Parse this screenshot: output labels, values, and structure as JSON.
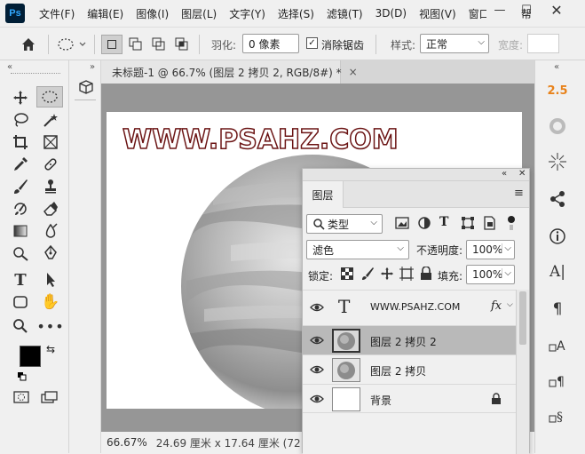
{
  "app": {
    "logo": "Ps"
  },
  "menubar": {
    "items": [
      "文件(F)",
      "编辑(E)",
      "图像(I)",
      "图层(L)",
      "文字(Y)",
      "选择(S)",
      "滤镜(T)",
      "3D(D)",
      "视图(V)",
      "窗口(W)",
      "帮"
    ],
    "minimize": "—",
    "restore": "☐"
  },
  "options": {
    "feather_label": "羽化:",
    "feather_value": "0 像素",
    "antialias_label": "消除锯齿",
    "style_label": "样式:",
    "style_value": "正常",
    "width_label": "宽度:"
  },
  "document": {
    "tab_title": "未标题-1 @ 66.7% (图层 2 拷贝 2, RGB/8#) *",
    "tab_close": "×",
    "watermark": "WWW.PSAHZ.COM",
    "zoom": "66.67%",
    "dimensions": "24.69 厘米 x 17.64 厘米 (72 ppi)"
  },
  "rightstrip": {
    "brush_size": "2.5"
  },
  "layers_panel": {
    "title": "图层",
    "filter_kind": "类型",
    "blend_mode": "滤色",
    "opacity_label": "不透明度:",
    "opacity_value": "100%",
    "lock_label": "锁定:",
    "fill_label": "填充:",
    "fill_value": "100%",
    "layers": [
      {
        "name": "WWW.PSAHZ.COM",
        "type": "text",
        "fx": "fx"
      },
      {
        "name": "图层 2 拷贝 2",
        "type": "image",
        "selected": true
      },
      {
        "name": "图层 2 拷贝",
        "type": "image"
      },
      {
        "name": "背景",
        "type": "background",
        "locked": true
      }
    ]
  },
  "colors": {
    "selection": "#b9b9b9",
    "watermark_text": "#ffffff",
    "watermark_stroke": "#6b1414",
    "accent_orange": "#e8821a"
  }
}
